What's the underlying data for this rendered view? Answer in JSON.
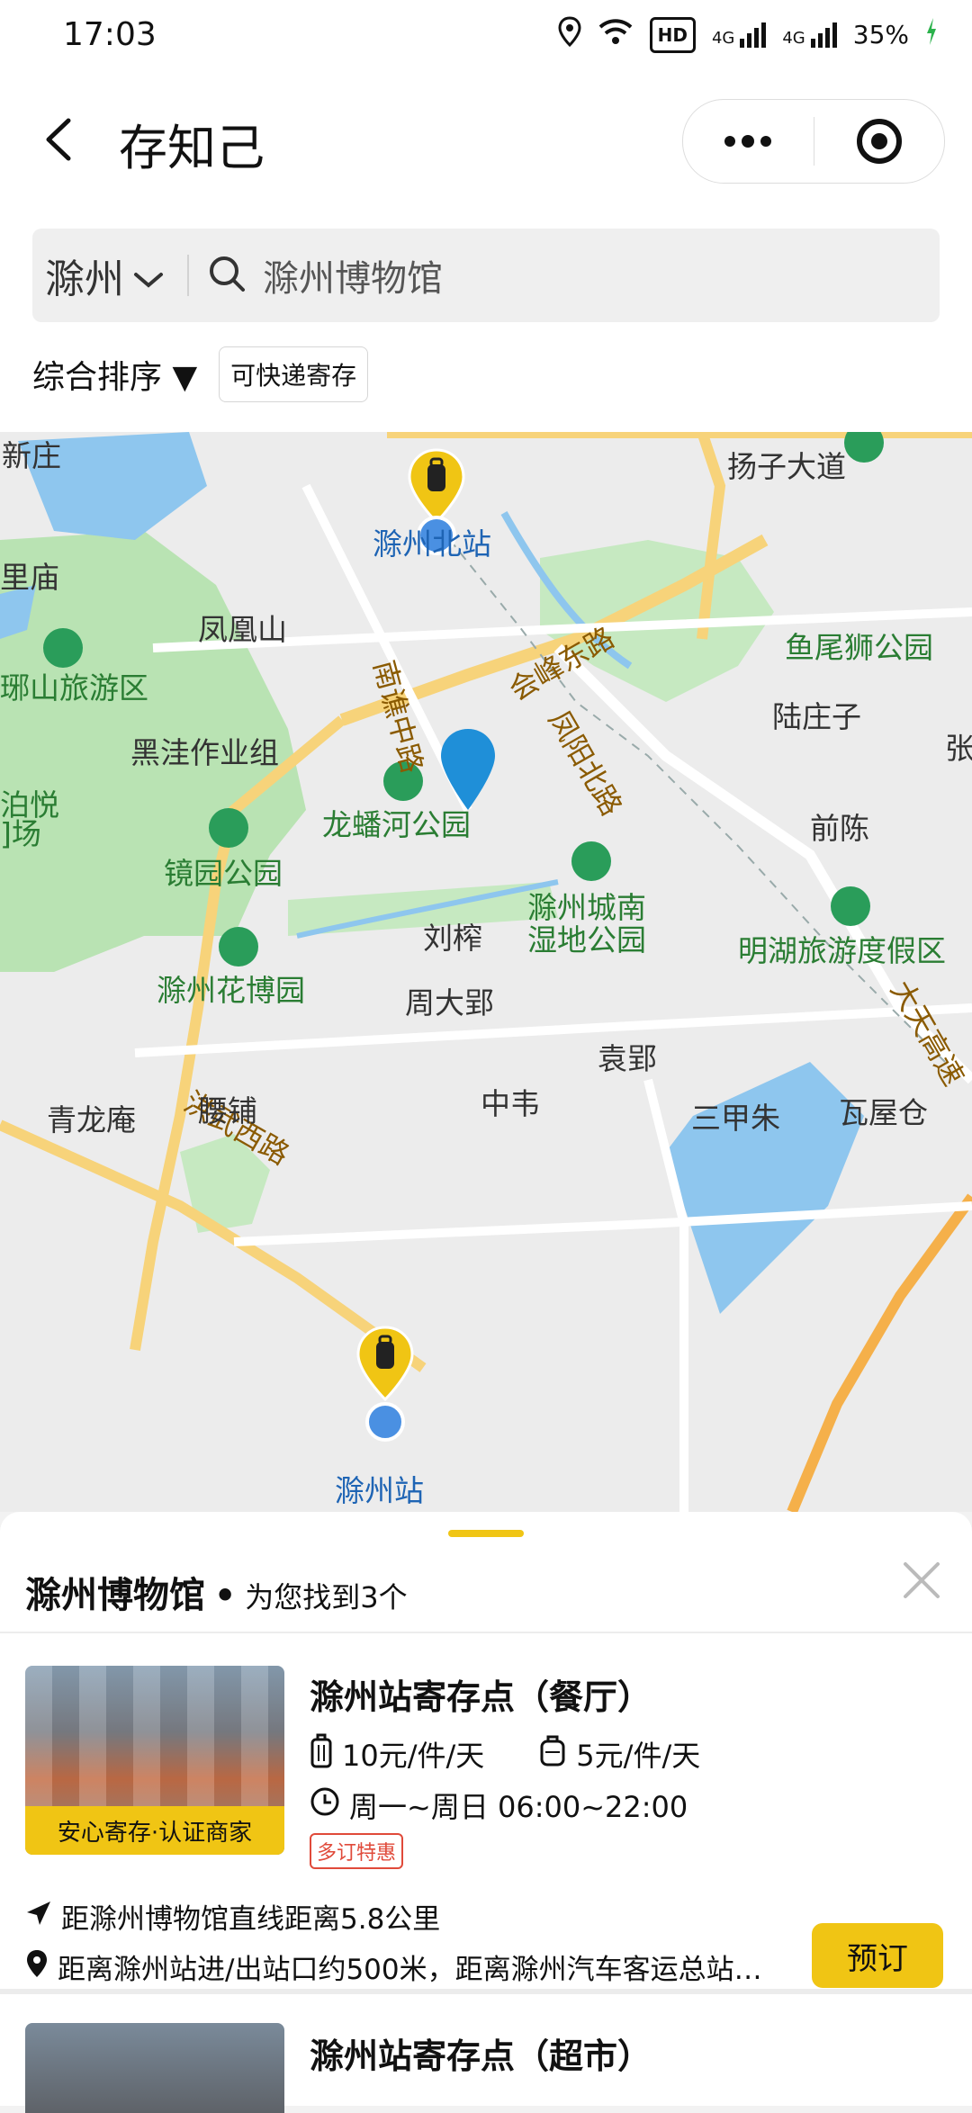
{
  "status_bar": {
    "time": "17:03",
    "battery": "35%",
    "net1": "4G",
    "net2": "4G",
    "hd": "HD"
  },
  "header": {
    "back": "back-icon",
    "title": "存知己"
  },
  "search": {
    "city": "滁州",
    "placeholder": "滁州博物馆"
  },
  "filters": {
    "sort": "综合排序 ▼",
    "tag": "可快递寄存"
  },
  "map": {
    "labels": [
      "新庄",
      "扬子大道",
      "滁州北站",
      "里庙",
      "凤凰山",
      "南谯中路",
      "会峰东路",
      "鱼尾狮公园",
      "琊山旅游区",
      "黑洼作业组",
      "陆庄子",
      "张",
      "泊悦",
      "]场",
      "龙蟠河公园",
      "凤阳北路",
      "前陈",
      "镜园公园",
      "滁州城南",
      "湿地公园",
      "刘榨",
      "明湖旅游度假区",
      "滁州花博园",
      "周大郢",
      "大天高速",
      "洪武西路",
      "袁郢",
      "青龙庵",
      "腰铺",
      "中韦",
      "三甲朱",
      "瓦屋仓",
      "滁州站"
    ]
  },
  "results": {
    "place": "滁州博物馆",
    "dot": "•",
    "found": "为您找到3个",
    "items": [
      {
        "name": "滁州站寄存点（餐厅）",
        "badge": "安心寄存·认证商家",
        "price_large": "10元/件/天",
        "price_small": "5元/件/天",
        "hours": "周一~周日 06:00~22:00",
        "promo": "多订特惠",
        "distance": "距滁州博物馆直线距离5.8公里",
        "address": "距离滁州站进/出站口约500米，距离滁州汽车客运总站…",
        "book": "预订"
      },
      {
        "name": "滁州站寄存点（超市）"
      }
    ]
  }
}
